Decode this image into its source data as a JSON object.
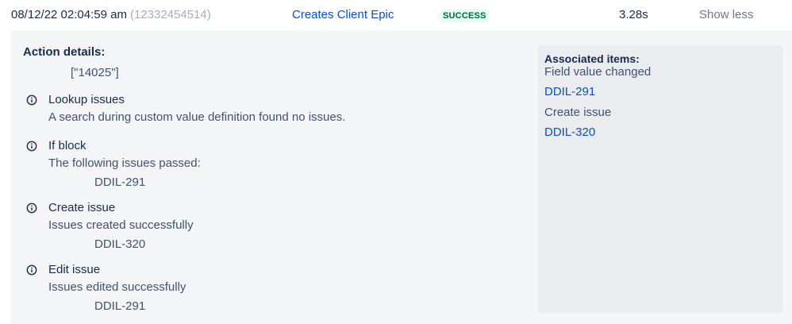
{
  "log_row": {
    "timestamp": "08/12/22 02:04:59 am",
    "execution_id": "(12332454514)",
    "rule_name": "Creates Client Epic",
    "status": "SUCCESS",
    "duration": "3.28s",
    "toggle_label": "Show less"
  },
  "action_details": {
    "title": "Action details:",
    "value": "[\"14025\"]",
    "items": [
      {
        "title": "Lookup issues",
        "description": "A search during custom value definition found no issues.",
        "key": ""
      },
      {
        "title": "If block",
        "description": "The following issues passed:",
        "key": "DDIL-291"
      },
      {
        "title": "Create issue",
        "description": "Issues created successfully",
        "key": "DDIL-320"
      },
      {
        "title": "Edit issue",
        "description": "Issues edited successfully",
        "key": "DDIL-291"
      }
    ]
  },
  "associated_items": {
    "title": "Associated items:",
    "groups": [
      {
        "label": "Field value changed",
        "link": "DDIL-291"
      },
      {
        "label": "Create issue",
        "link": "DDIL-320"
      }
    ]
  },
  "colors": {
    "link": "#0052cc",
    "success_bg": "#e3fcef",
    "success_text": "#006644",
    "panel_bg": "#f4f5f7",
    "side_panel_bg": "#ebecf0"
  },
  "icons": {
    "info": "info-circle-icon"
  }
}
